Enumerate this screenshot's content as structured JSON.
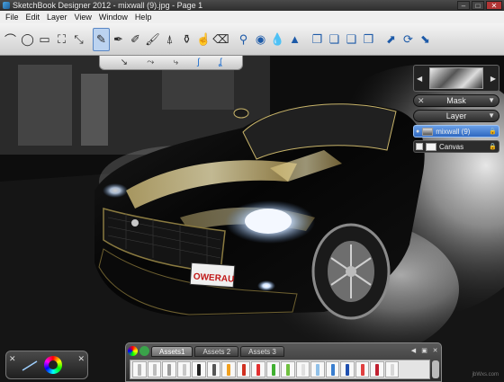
{
  "window": {
    "title": "SketchBook Designer 2012 - mixwall (9).jpg - Page 1",
    "minimize": "–",
    "maximize": "□",
    "close": "✕"
  },
  "menu": [
    "File",
    "Edit",
    "Layer",
    "View",
    "Window",
    "Help"
  ],
  "toolbar": {
    "tools": [
      {
        "name": "lasso-select-icon",
        "glyph": "⌒"
      },
      {
        "name": "ellipse-icon",
        "glyph": "◯"
      },
      {
        "name": "rectangle-icon",
        "glyph": "▭"
      },
      {
        "name": "crop-icon",
        "glyph": "⛶"
      },
      {
        "name": "transform-icon",
        "glyph": "⤡"
      },
      {
        "name": "pencil-icon",
        "glyph": "✎",
        "active": true
      },
      {
        "name": "ballpoint-pen-icon",
        "glyph": "✒"
      },
      {
        "name": "marker-icon",
        "glyph": "✐"
      },
      {
        "name": "brush-icon",
        "glyph": "🖌"
      },
      {
        "name": "airbrush-icon",
        "glyph": "⍋"
      },
      {
        "name": "paint-bucket-icon",
        "glyph": "⚱"
      },
      {
        "name": "smudge-icon",
        "glyph": "☝"
      },
      {
        "name": "eraser-icon",
        "glyph": "⌫"
      },
      {
        "name": "magnifier-icon",
        "glyph": "⚲",
        "blue": true
      },
      {
        "name": "blur-icon",
        "glyph": "◉",
        "blue": true
      },
      {
        "name": "sharpen-icon",
        "glyph": "💧",
        "blue": true
      },
      {
        "name": "fill-drop-icon",
        "glyph": "▲",
        "blue": true
      },
      {
        "name": "layer-copy-icon",
        "glyph": "❐",
        "blue": true
      },
      {
        "name": "layer-merge-icon",
        "glyph": "❏",
        "blue": true
      },
      {
        "name": "layer-add-icon",
        "glyph": "❑",
        "blue": true
      },
      {
        "name": "layer-stack-icon",
        "glyph": "❒",
        "blue": true
      },
      {
        "name": "move-icon",
        "glyph": "⬈",
        "blue": true
      },
      {
        "name": "rotate-icon",
        "glyph": "⟳",
        "blue": true
      },
      {
        "name": "scale-icon",
        "glyph": "⬊",
        "blue": true
      }
    ]
  },
  "brush_strip": {
    "items": [
      {
        "name": "brush-stroke-a-icon",
        "glyph": "↘"
      },
      {
        "name": "brush-stroke-b-icon",
        "glyph": "⤳"
      },
      {
        "name": "brush-stroke-c-icon",
        "glyph": "⤷"
      },
      {
        "name": "symmetry-a-icon",
        "glyph": "ʃ",
        "blue": true
      },
      {
        "name": "symmetry-b-icon",
        "glyph": "ʆ",
        "blue": true
      }
    ]
  },
  "layers": {
    "mask_label": "Mask",
    "layer_label": "Layer",
    "items": [
      {
        "name": "mixwall (9)",
        "active": true
      },
      {
        "name": "Canvas",
        "active": false
      }
    ]
  },
  "assets": {
    "tabs": [
      "Assets1",
      "Assets 2",
      "Assets 3"
    ],
    "active_tab": 0,
    "swatches": [
      "#b8b8b8",
      "#bdbdbd",
      "#9c9c9c",
      "#c8c8c8",
      "#222222",
      "#555555",
      "#f0a020",
      "#d03020",
      "#e23030",
      "#40b030",
      "#70c040",
      "#e0e0e0",
      "#90c0e8",
      "#3a7fd0",
      "#2050b0",
      "#e04040",
      "#c02030",
      "#d8d8d8"
    ]
  },
  "photo": {
    "plate_text": "OWERAU"
  },
  "watermark": "jbWxs.com"
}
